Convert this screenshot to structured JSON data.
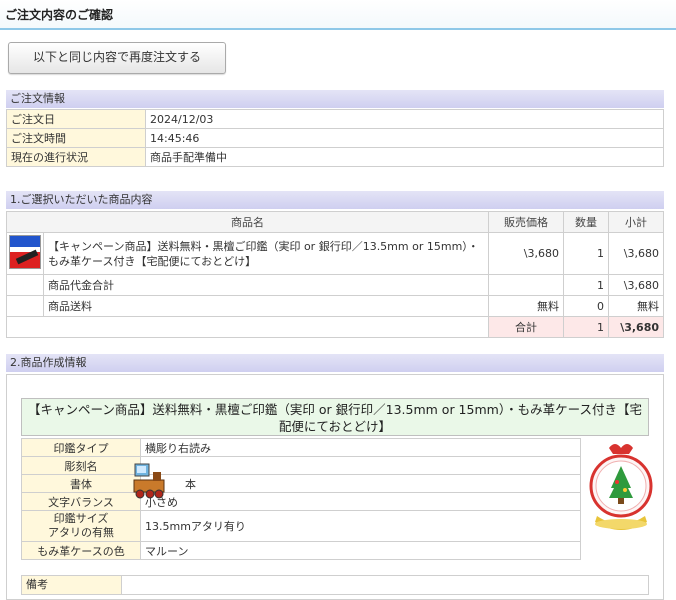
{
  "header": {
    "title": "ご注文内容のご確認"
  },
  "reorder_button": "以下と同じ内容で再度注文する",
  "order_info": {
    "heading": "ご注文情報",
    "rows": [
      {
        "label": "ご注文日",
        "value": "2024/12/03"
      },
      {
        "label": "ご注文時間",
        "value": "14:45:46"
      },
      {
        "label": "現在の進行状況",
        "value": "商品手配準備中"
      }
    ]
  },
  "items": {
    "heading": "1.ご選択いただいた商品内容",
    "columns": {
      "name": "商品名",
      "price": "販売価格",
      "qty": "数量",
      "subtotal": "小計"
    },
    "product": {
      "name": "【キャンペーン商品】送料無料・黒檀ご印鑑（実印 or 銀行印／13.5mm or 15mm）・もみ革ケース付き【宅配便にておとどけ】",
      "price": "\\3,680",
      "qty": "1",
      "subtotal": "\\3,680",
      "thumb_icon": "product-thumbnail"
    },
    "goods_total": {
      "label": "商品代金合計",
      "qty": "1",
      "subtotal": "\\3,680"
    },
    "shipping": {
      "label": "商品送料",
      "price": "無料",
      "qty": "0",
      "subtotal": "無料"
    },
    "total": {
      "label": "合計",
      "qty": "1",
      "subtotal": "\\3,680"
    }
  },
  "creation": {
    "heading": "2.商品作成情報",
    "product_title": "【キャンペーン商品】送料無料・黒檀ご印鑑（実印 or 銀行印／13.5mm or 15mm）・もみ革ケース付き【宅配便にておとどけ】",
    "specs": [
      {
        "label": "印鑑タイプ",
        "value": "横彫り右読み"
      },
      {
        "label": "彫刻名",
        "value": ""
      },
      {
        "label": "書体",
        "value": "本"
      },
      {
        "label": "文字バランス",
        "value": "小さめ"
      },
      {
        "label": "印鑑サイズ\nアタリの有無",
        "value": "13.5mmアタリ有り"
      },
      {
        "label": "もみ革ケースの色",
        "value": "マルーン"
      }
    ],
    "remarks_label": "備考",
    "seal_image": "snow-globe-seal-image",
    "overlay_image": "toy-train-image"
  }
}
